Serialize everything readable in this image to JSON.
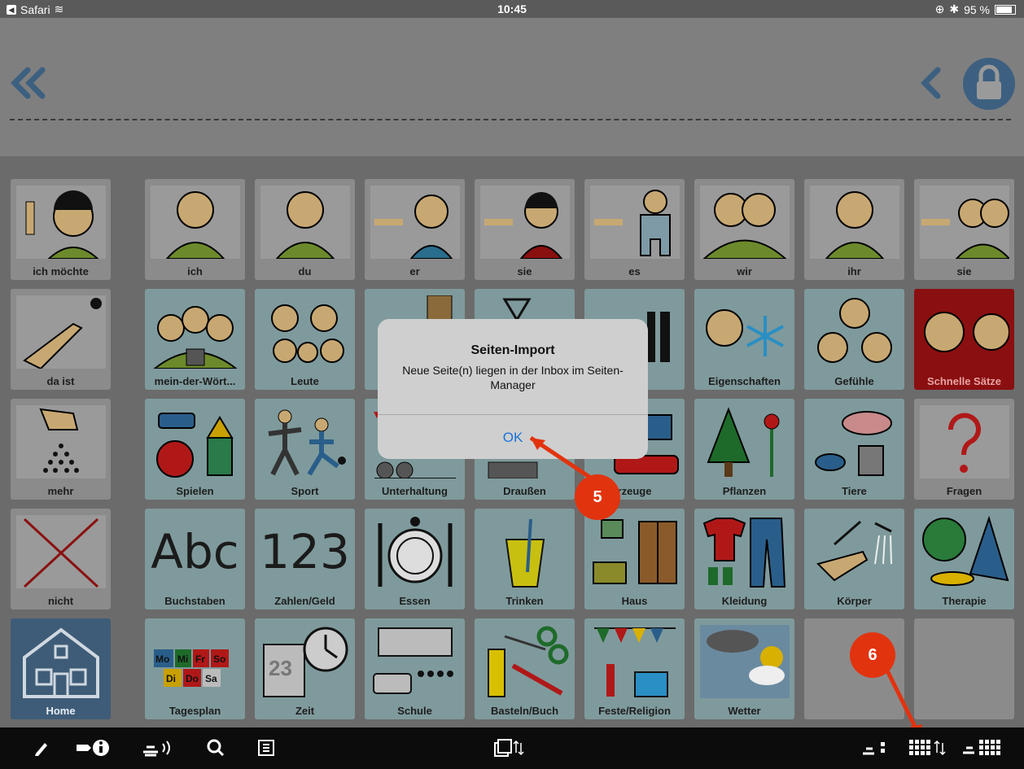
{
  "statusbar": {
    "app": "Safari",
    "time": "10:45",
    "battery": "95 %"
  },
  "dialog": {
    "title": "Seiten-Import",
    "message": "Neue Seite(n) liegen in der Inbox im Seiten-Manager",
    "ok": "OK"
  },
  "callouts": {
    "first": "5",
    "second": "6"
  },
  "grid": {
    "row1": [
      "ich möchte",
      "ich",
      "du",
      "er",
      "sie",
      "es",
      "wir",
      "ihr",
      "sie"
    ],
    "row2": [
      "da ist",
      "mein-der-Wört...",
      "Leute",
      "",
      "",
      "örter",
      "Eigenschaften",
      "Gefühle",
      "Schnelle Sätze"
    ],
    "row3": [
      "mehr",
      "Spielen",
      "Sport",
      "Unterhaltung",
      "Draußen",
      "rzeuge",
      "Pflanzen",
      "Tiere",
      "Fragen"
    ],
    "row4": [
      "nicht",
      "Buchstaben",
      "Zahlen/Geld",
      "Essen",
      "Trinken",
      "Haus",
      "Kleidung",
      "Körper",
      "Therapie"
    ],
    "row5": [
      "Home",
      "Tagesplan",
      "Zeit",
      "Schule",
      "Basteln/Buch",
      "Feste/Religion",
      "Wetter",
      "",
      ""
    ]
  },
  "symbols": {
    "abc": "Abc",
    "num": "123",
    "days": [
      "Mo",
      "Mi",
      "Fr",
      "So",
      "Di",
      "Do",
      "Sa"
    ],
    "calendar_day": "23"
  },
  "colors": {
    "accent": "#1a72d9",
    "callout": "#e2330f",
    "selected_red": "#8a0f10"
  }
}
